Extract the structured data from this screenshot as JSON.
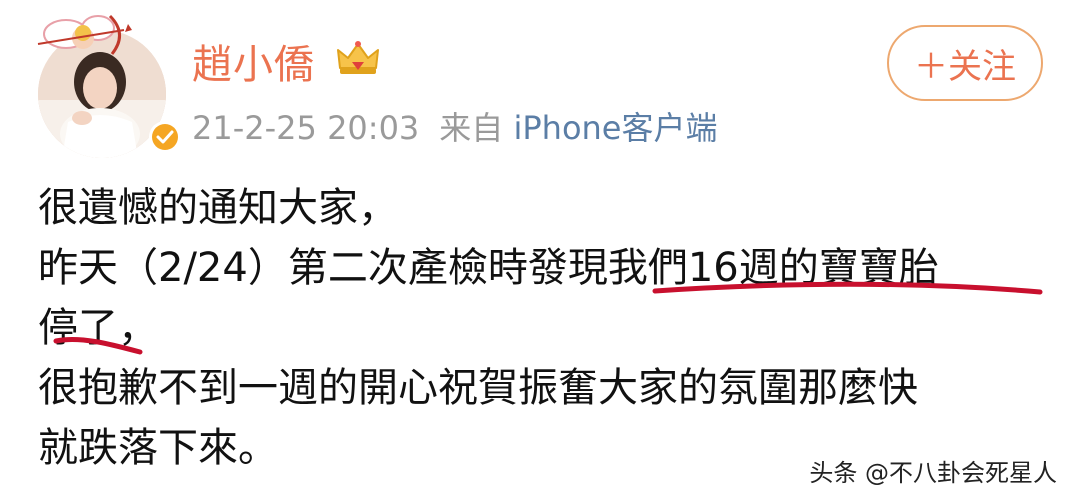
{
  "post": {
    "username": "趙小僑",
    "date": "21-2-25 20:03",
    "source_prefix": "来自",
    "source_client": "iPhone客户端",
    "follow_label": "＋关注",
    "content_lines": [
      "很遺憾的通知大家，",
      "昨天（2/24）第二次產檢時發現我們16週的寶寶胎",
      "停了，",
      "很抱歉不到一週的開心祝賀振奮大家的氛圍那麼快",
      "就跌落下來。"
    ]
  },
  "watermark": "头条 @不八卦会死星人",
  "icons": {
    "avatar": "avatar",
    "avatar_decoration": "cupid-icon",
    "verified": "verified-badge-icon",
    "vip": "crown-icon"
  },
  "colors": {
    "username": "#eb7350",
    "follow_border": "#eda86f",
    "meta_gray": "#9a9a9a",
    "source_blue": "#5b7ea6",
    "underline_red": "#c8102e",
    "verified_gold": "#f5a623"
  }
}
